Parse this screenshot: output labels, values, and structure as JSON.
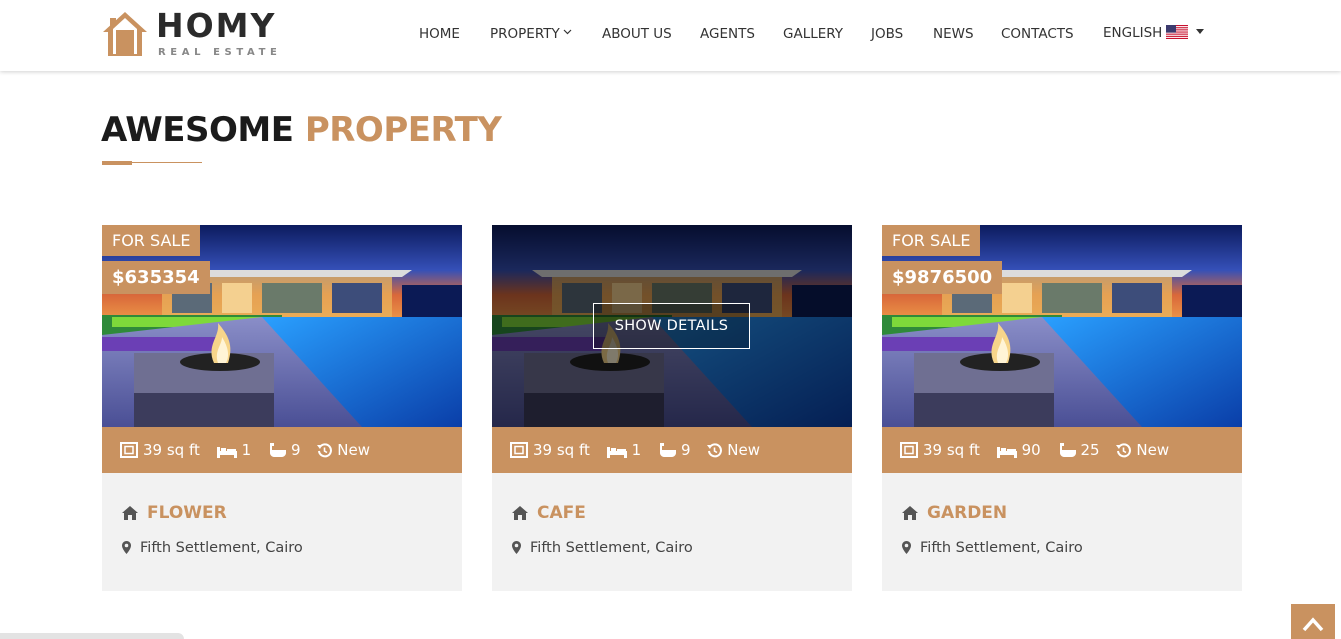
{
  "brand": {
    "name": "HOMY",
    "tagline": "REAL ESTATE",
    "color": "#c99260"
  },
  "nav": {
    "items": [
      {
        "label": "HOME"
      },
      {
        "label": "PROPERTY",
        "icon": "chevron-down-icon"
      },
      {
        "label": "ABOUT US"
      },
      {
        "label": "AGENTS"
      },
      {
        "label": "GALLERY"
      },
      {
        "label": "JOBS"
      },
      {
        "label": "NEWS"
      },
      {
        "label": "CONTACTS"
      }
    ],
    "language": {
      "label": "ENGLISH",
      "icon": "us-flag-icon"
    }
  },
  "section": {
    "title_main": "AWESOME",
    "title_accent": "PROPERTY"
  },
  "cards": [
    {
      "status": "FOR SALE",
      "price": "$635354",
      "area": "39 sq ft",
      "beds": "1",
      "baths": "9",
      "condition": "New",
      "title": "FLOWER",
      "location": "Fifth Settlement, Cairo"
    },
    {
      "hover_label": "SHOW DETAILS",
      "area": "39 sq ft",
      "beds": "1",
      "baths": "9",
      "condition": "New",
      "title": "CAFE",
      "location": "Fifth Settlement, Cairo"
    },
    {
      "status": "FOR SALE",
      "price": "$9876500",
      "area": "39 sq ft",
      "beds": "90",
      "baths": "25",
      "condition": "New",
      "title": "GARDEN",
      "location": "Fifth Settlement, Cairo"
    }
  ],
  "scroll_top": {
    "icon": "chevron-up-icon"
  }
}
